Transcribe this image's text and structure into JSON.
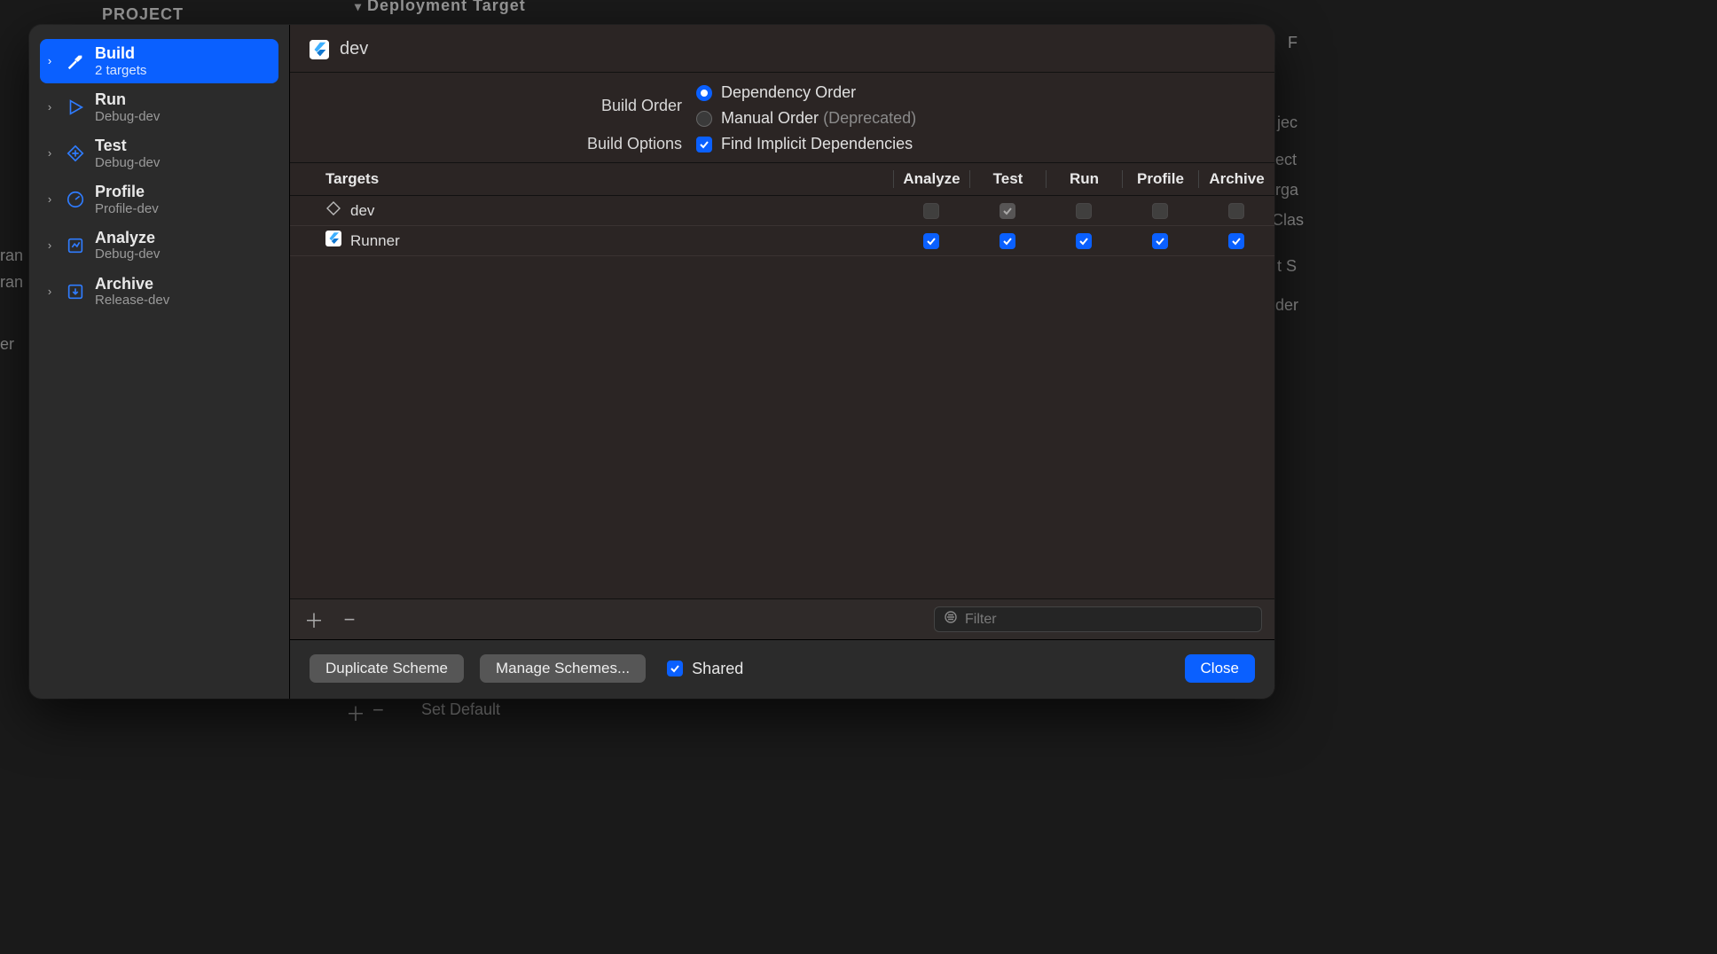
{
  "background": {
    "project_label": "PROJECT",
    "deployment_target": "Deployment Target",
    "ran1": "ran",
    "ran2": "ran",
    "er": "er",
    "set_default": "Set Default",
    "right_f": "F",
    "right_jec": "jec",
    "right_ect": "ect",
    "right_rga": "rga",
    "right_clas": "Clas",
    "right_ts": "t S",
    "right_der": "der"
  },
  "sidebar": {
    "items": [
      {
        "title": "Build",
        "sub": "2 targets"
      },
      {
        "title": "Run",
        "sub": "Debug-dev"
      },
      {
        "title": "Test",
        "sub": "Debug-dev"
      },
      {
        "title": "Profile",
        "sub": "Profile-dev"
      },
      {
        "title": "Analyze",
        "sub": "Debug-dev"
      },
      {
        "title": "Archive",
        "sub": "Release-dev"
      }
    ]
  },
  "main": {
    "scheme_name": "dev",
    "build_order_label": "Build Order",
    "dependency_order": "Dependency Order",
    "manual_order": "Manual Order",
    "manual_order_dep": "(Deprecated)",
    "build_options_label": "Build Options",
    "find_implicit": "Find Implicit Dependencies",
    "columns": {
      "targets": "Targets",
      "analyze": "Analyze",
      "test": "Test",
      "run": "Run",
      "profile": "Profile",
      "archive": "Archive"
    },
    "rows": [
      {
        "name": "dev",
        "icon": "diamond",
        "analyze": "disabled",
        "test": "disabled-checked",
        "run": "disabled",
        "profile": "disabled",
        "archive": "disabled"
      },
      {
        "name": "Runner",
        "icon": "flutter",
        "analyze": "checked",
        "test": "checked",
        "run": "checked",
        "profile": "checked",
        "archive": "checked"
      }
    ],
    "filter_placeholder": "Filter"
  },
  "footer": {
    "duplicate": "Duplicate Scheme",
    "manage": "Manage Schemes...",
    "shared": "Shared",
    "close": "Close"
  }
}
